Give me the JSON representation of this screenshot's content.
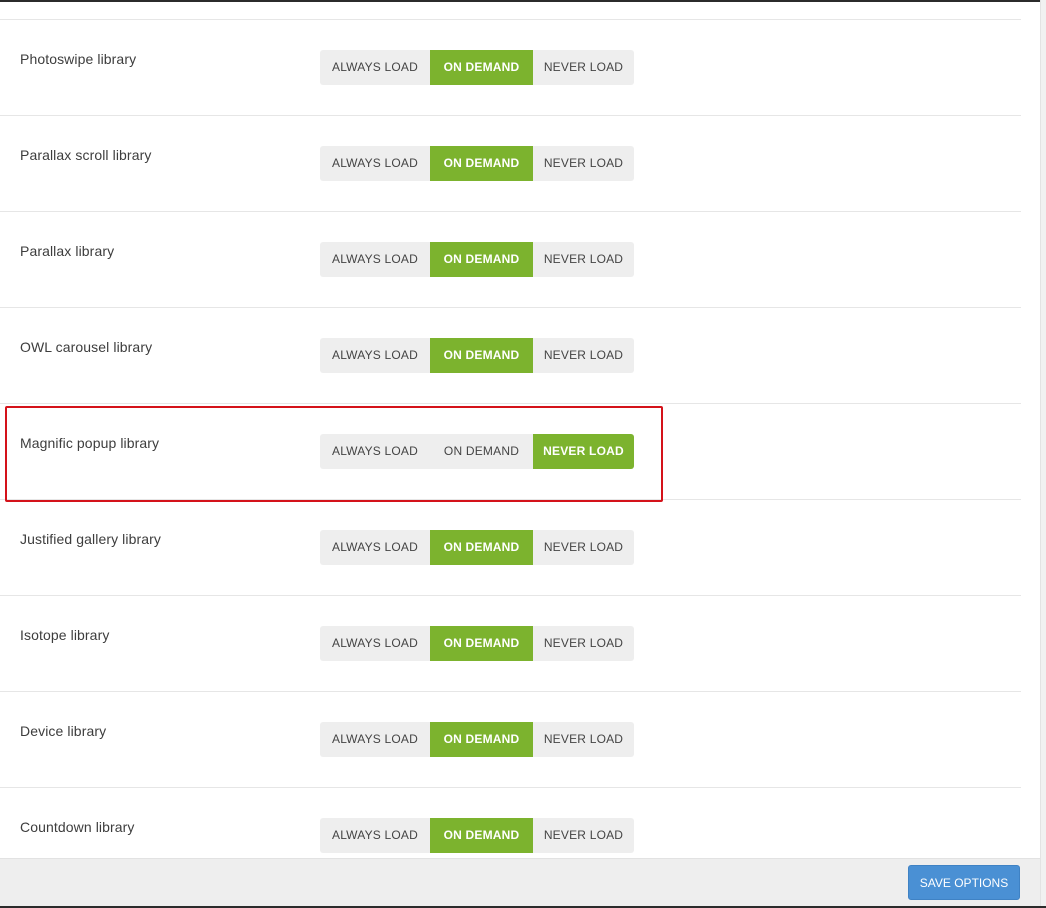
{
  "toggle_labels": {
    "always": "ALWAYS LOAD",
    "demand": "ON DEMAND",
    "never": "NEVER LOAD"
  },
  "options": [
    {
      "label": "Photoswipe library",
      "selected": "demand"
    },
    {
      "label": "Parallax scroll library",
      "selected": "demand"
    },
    {
      "label": "Parallax library",
      "selected": "demand"
    },
    {
      "label": "OWL carousel library",
      "selected": "demand"
    },
    {
      "label": "Magnific popup library",
      "selected": "never",
      "highlighted": true
    },
    {
      "label": "Justified gallery library",
      "selected": "demand"
    },
    {
      "label": "Isotope library",
      "selected": "demand"
    },
    {
      "label": "Device library",
      "selected": "demand"
    },
    {
      "label": "Countdown library",
      "selected": "demand"
    }
  ],
  "footer": {
    "save_label": "SAVE OPTIONS"
  },
  "colors": {
    "active": "#7cb32e",
    "highlight": "#d4121a",
    "save": "#4a90d4"
  }
}
